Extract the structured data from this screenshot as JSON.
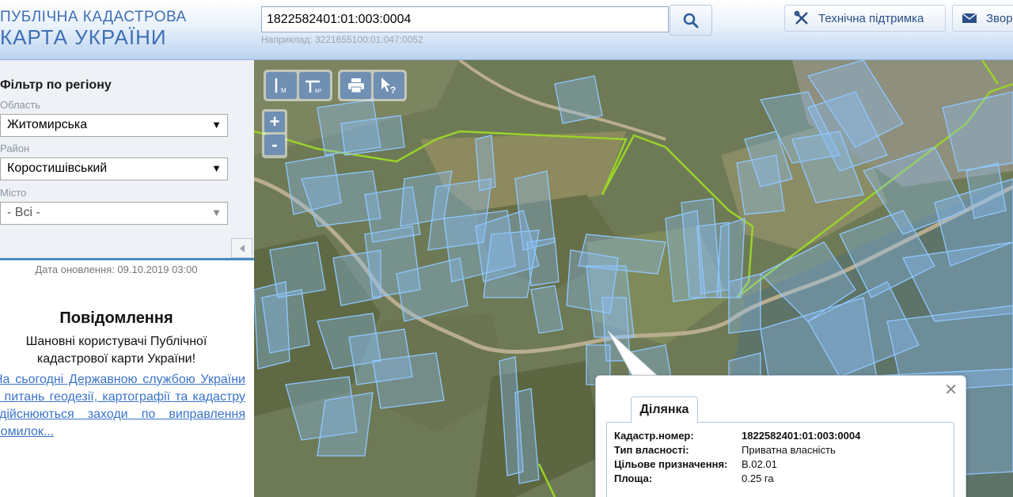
{
  "header": {
    "logo_line1": "ПУБЛІЧНА КАДАСТРОВА",
    "logo_line2": "КАРТА УКРАЇНИ",
    "search_value": "1822582401:01:003:0004",
    "search_hint": "Наприклад: 3221655100:01:047:0052",
    "support_label": "Технічна підтримка",
    "feedback_label": "Звор"
  },
  "sidebar": {
    "filter_title": "Фільтр по регіону",
    "region_label": "Область",
    "region_value": "Житомирська",
    "district_label": "Район",
    "district_value": "Коростишівський",
    "city_label": "Місто",
    "city_value": "- Всі -",
    "update_date": "Дата оновлення: 09.10.2019 03:00",
    "notice_title": "Повідомлення",
    "notice_text": "Шановні користувачі Публічної кадастрової карти України!",
    "notice_link": "На сьогодні Державною службою України з питань геодезії, картографії та кадастру здійснюються заходи по виправлення помилок..."
  },
  "map": {
    "tools": [
      "measure-length-icon",
      "measure-area-icon",
      "print-icon",
      "identify-icon"
    ],
    "zoom_in": "+",
    "zoom_out": "-"
  },
  "popup": {
    "tab_label": "Ділянка",
    "rows": [
      {
        "key": "Кадастр.номер:",
        "value": "1822582401:01:003:0004"
      },
      {
        "key": "Тип власності:",
        "value": "Приватна власність"
      },
      {
        "key": "Цільове призначення:",
        "value": "В.02.01"
      },
      {
        "key": "Площа:",
        "value": "0.25 га"
      }
    ]
  },
  "colors": {
    "brand_blue": "#3f6fb4",
    "parcel_outline": "#8fc8ff",
    "boundary_line": "#9ad22a",
    "link": "#3a73c9"
  }
}
